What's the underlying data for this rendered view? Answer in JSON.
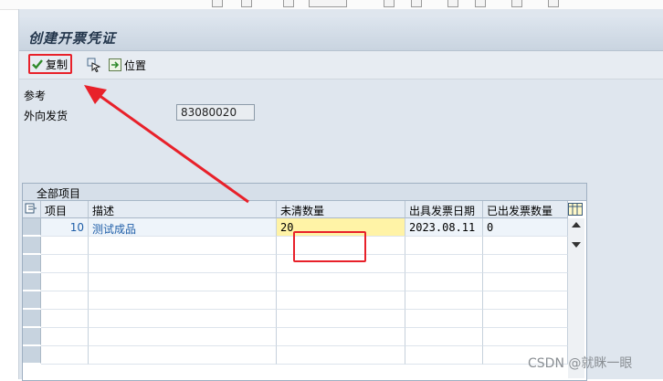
{
  "window": {
    "title": "创建开票凭证"
  },
  "toolbar": {
    "copy_label": "复制",
    "position_label": "位置"
  },
  "reference": {
    "section_label": "参考",
    "outbound_label": "外向发货",
    "outbound_value": "83080020"
  },
  "table": {
    "title": "全部项目",
    "columns": [
      "项目",
      "描述",
      "未清数量",
      "出具发票日期",
      "已出发票数量"
    ],
    "rows": [
      {
        "item": "10",
        "description": "测试成品",
        "open_qty": "20",
        "billing_date": "2023.08.11",
        "billed_qty": "0"
      }
    ]
  },
  "watermark": "CSDN @就眯一眼",
  "colors": {
    "highlight_red": "#e8212a",
    "input_yellow": "#fff3a6",
    "title_text": "#23364c"
  }
}
